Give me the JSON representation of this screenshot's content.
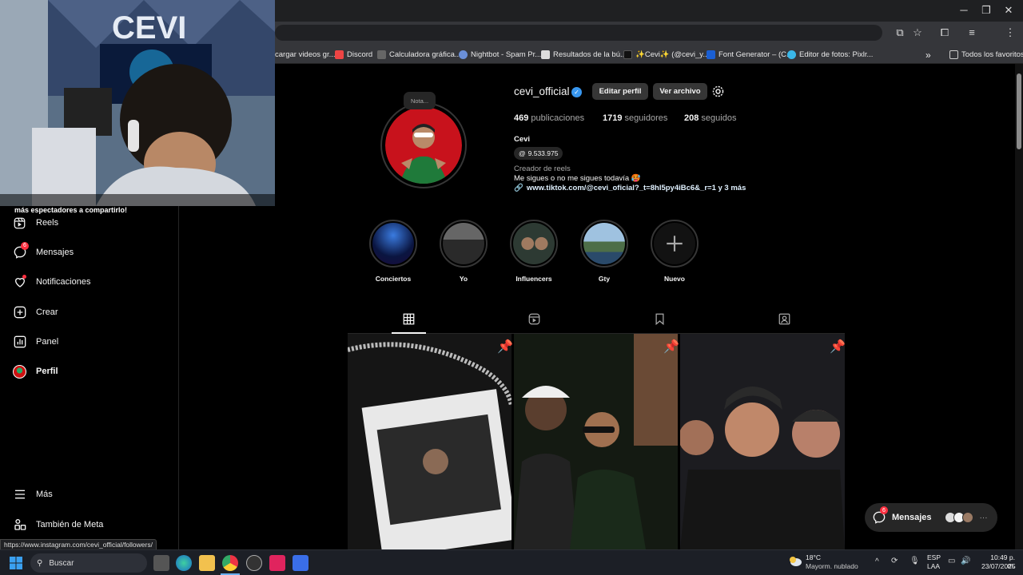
{
  "bookmarks": [
    {
      "label": "cargar videos gr...",
      "color": "#888"
    },
    {
      "label": "Discord",
      "color": "#e44"
    },
    {
      "label": "Calculadora gráfica...",
      "color": "#aaa"
    },
    {
      "label": "Nightbot - Spam Pr...",
      "color": "#6a8fd8"
    },
    {
      "label": "Resultados de la bú...",
      "color": "#ddd"
    },
    {
      "label": "✨Cevi✨ (@cevi_y...",
      "color": "#222"
    },
    {
      "label": "Font Generator – (C...",
      "color": "#1a5fd4"
    },
    {
      "label": "Editor de fotos: Pixlr...",
      "color": "#3ab7e8"
    }
  ],
  "bookmarks_all": "Todos los favoritos",
  "webcam_caption": "más espectadores a compartirlo!",
  "sidebar": {
    "items": [
      {
        "label": "Reels",
        "icon": "reels-icon"
      },
      {
        "label": "Mensajes",
        "icon": "messenger-icon",
        "badge": "6"
      },
      {
        "label": "Notificaciones",
        "icon": "heart-icon"
      },
      {
        "label": "Crear",
        "icon": "plus-square-icon"
      },
      {
        "label": "Panel",
        "icon": "chart-icon"
      },
      {
        "label": "Perfil",
        "icon": "avatar-icon"
      }
    ],
    "more": "Más",
    "meta": "También de Meta"
  },
  "profile": {
    "note": "Nota...",
    "username": "cevi_official",
    "edit_button": "Editar perfil",
    "archive_button": "Ver archivo",
    "posts_count": "469",
    "posts_label": "publicaciones",
    "followers_count": "1719",
    "followers_label": "seguidores",
    "following_count": "208",
    "following_label": "seguidos",
    "name": "Cevi",
    "threads": "9.533.975",
    "category": "Creador de reels",
    "bio": "Me sigues o no me sigues todavía 🥵",
    "link": "www.tiktok.com/@cevi_oficial?_t=8hI5py4iBc6&_r=1 y 3 más"
  },
  "highlights": [
    {
      "label": "Conciertos"
    },
    {
      "label": "Yo"
    },
    {
      "label": "Influencers"
    },
    {
      "label": "Gty"
    },
    {
      "label": "Nuevo"
    }
  ],
  "messages_widget": {
    "label": "Mensajes",
    "badge": "6"
  },
  "status_url": "https://www.instagram.com/cevi_official/followers/",
  "taskbar": {
    "search": "Buscar",
    "weather_temp": "18°C",
    "weather_desc": "Mayorm. nublado",
    "lang1": "ESP",
    "lang2": "LAA",
    "time": "10:49 p. m.",
    "date": "23/07/2025"
  }
}
